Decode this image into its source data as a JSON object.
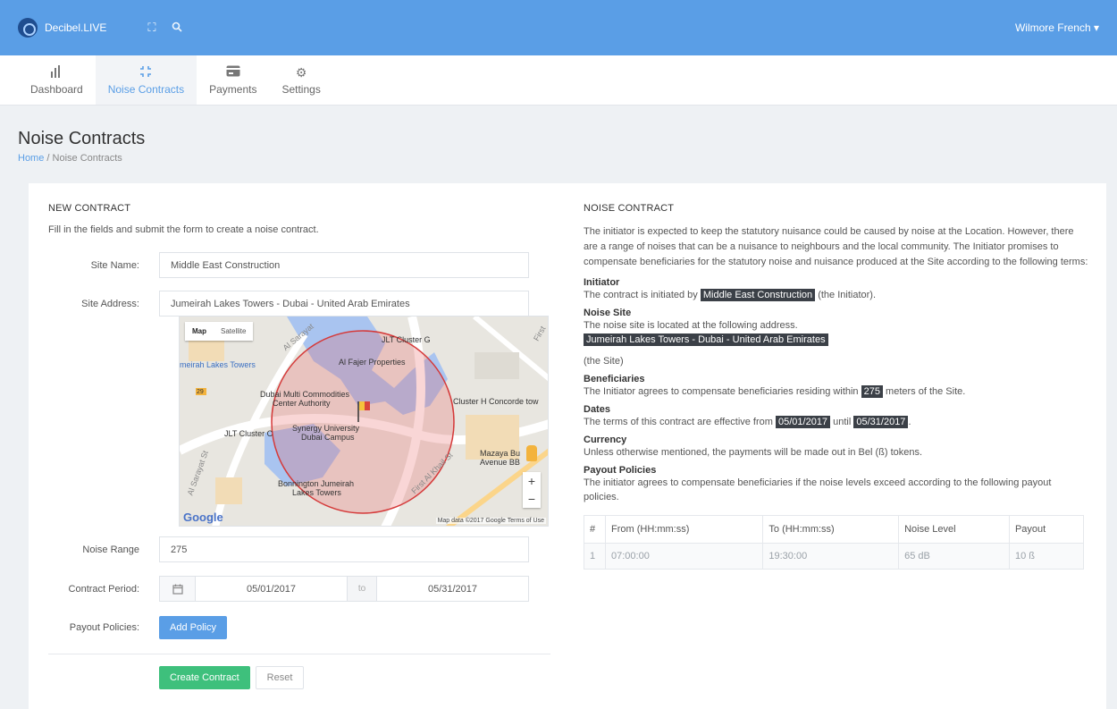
{
  "app": {
    "name": "Decibel.LIVE",
    "user": "Wilmore French ▾"
  },
  "tabs": [
    {
      "label": "Dashboard",
      "icon": "bar-chart-icon"
    },
    {
      "label": "Noise Contracts",
      "icon": "compress-icon"
    },
    {
      "label": "Payments",
      "icon": "credit-card-icon"
    },
    {
      "label": "Settings",
      "icon": "gear-icon"
    }
  ],
  "page": {
    "title": "Noise Contracts",
    "breadcrumb_home": "Home",
    "breadcrumb_sep": "/",
    "breadcrumb_current": "Noise Contracts"
  },
  "form": {
    "title": "NEW CONTRACT",
    "description": "Fill in the fields and submit the form to create a noise contract.",
    "site_name_label": "Site Name:",
    "site_name_value": "Middle East Construction",
    "site_address_label": "Site Address:",
    "site_address_value": "Jumeirah Lakes Towers - Dubai - United Arab Emirates",
    "noise_range_label": "Noise Range",
    "noise_range_value": "275",
    "contract_period_label": "Contract Period:",
    "start_date": "05/01/2017",
    "to_label": "to",
    "end_date": "05/31/2017",
    "payout_label": "Payout Policies:",
    "add_policy": "Add Policy",
    "create": "Create Contract",
    "reset": "Reset"
  },
  "map": {
    "map_tab": "Map",
    "satellite_tab": "Satellite",
    "google": "Google",
    "credit": "Map data ©2017 Google   Terms of Use",
    "zoom_in": "+",
    "zoom_out": "−",
    "labels": {
      "jlt_g": "JLT Cluster G",
      "fajer": "Al Fajer Properties",
      "jlt_station": "meirah Lakes Towers",
      "dmcc_1": "Dubai Multi Commodities",
      "dmcc_2": "Center Authority",
      "cluster_h": "Cluster H Concorde tow",
      "jlt_c": "JLT Cluster C",
      "synergy_1": "Synergy University",
      "synergy_2": "Dubai Campus",
      "mazaya_1": "Mazaya Bu",
      "mazaya_2": "Avenue BB",
      "bonnington_1": "Bonnington Jumeirah",
      "bonnington_2": "Lakes Towers",
      "road_sarayat": "Al Sarayat",
      "road_sarayat_st": "Al Sarayat St",
      "road_khail": "First Al Khail St",
      "road_first": "First",
      "shield": "29"
    }
  },
  "contract": {
    "title": "NOISE CONTRACT",
    "intro": "The initiator is expected to keep the statutory nuisance could be caused by noise at the Location. However, there are a range of noises that can be a nuisance to neighbours and the local community. The Initiator promises to compensate beneficiaries for the statutory noise and nuisance produced at the Site according to the following terms:",
    "initiator_head": "Initiator",
    "initiator_pre": "The contract is initiated by",
    "initiator_name": "Middle East Construction",
    "initiator_post": "(the Initiator).",
    "site_head": "Noise Site",
    "site_pre": "The noise site is located at the following address.",
    "site_address": "Jumeirah Lakes Towers - Dubai - United Arab Emirates",
    "site_post": "(the Site)",
    "benef_head": "Beneficiaries",
    "benef_pre": "The Initiator agrees to compensate beneficiaries residing within",
    "benef_range": "275",
    "benef_post": "meters of the Site.",
    "dates_head": "Dates",
    "dates_pre": "The terms of this contract are effective from",
    "dates_start": "05/01/2017",
    "dates_mid": "until",
    "dates_end": "05/31/2017",
    "dates_post": ".",
    "currency_head": "Currency",
    "currency_text": "Unless otherwise mentioned, the payments will be made out in Bel (ß) tokens.",
    "payout_head": "Payout Policies",
    "payout_text": "The initiator agrees to compensate beneficiaries if the noise levels exceed according to the following payout policies.",
    "table": {
      "headers": [
        "#",
        "From (HH:mm:ss)",
        "To (HH:mm:ss)",
        "Noise Level",
        "Payout"
      ],
      "rows": [
        [
          "1",
          "07:00:00",
          "19:30:00",
          "65 dB",
          "10 ß"
        ]
      ]
    }
  }
}
